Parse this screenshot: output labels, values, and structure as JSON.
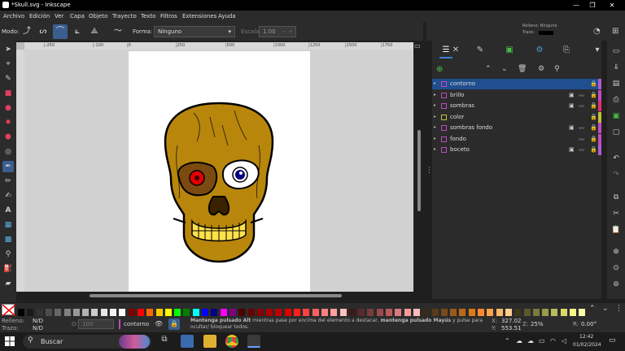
{
  "window": {
    "title": "*Skull.svg - Inkscape"
  },
  "menu": [
    "Archivo",
    "Edición",
    "Ver",
    "Capa",
    "Objeto",
    "Trayecto",
    "Texto",
    "Filtros",
    "Extensiones",
    "Ayuda"
  ],
  "commandbar": {
    "mode_label": "Modo:",
    "forma_label": "Forma:",
    "forma_value": "Ninguno",
    "escala_label": "Escala:",
    "escala_value": "1.00"
  },
  "style_indicator": {
    "relleno": "Relleno: Ninguno",
    "trazo": "Trazo:"
  },
  "ruler": {
    "ticks": [
      "|-250",
      "|-100",
      "|0",
      "|250",
      "|500",
      "|1000",
      "|1250",
      "|1500",
      "|1750"
    ]
  },
  "layers": [
    {
      "name": "contorno",
      "selected": true,
      "icons": [
        "lock"
      ],
      "color": "#b05ad0"
    },
    {
      "name": "brillo",
      "icons": [
        "mask",
        "visible",
        "lock"
      ],
      "color": "#c04ac0"
    },
    {
      "name": "sombras",
      "icons": [
        "mask",
        "visible",
        "lock"
      ],
      "color": "#e0306a"
    },
    {
      "name": "color",
      "icons": [
        "lock"
      ],
      "color": "#c0c040"
    },
    {
      "name": "sombras fondo",
      "icons": [
        "mask",
        "visible",
        "lock"
      ],
      "color": "#c04ac0"
    },
    {
      "name": "fondo",
      "icons": [
        "visible",
        "lock"
      ],
      "color": "#c04ac0"
    },
    {
      "name": "boceto",
      "icons": [
        "mask",
        "visible",
        "lock"
      ],
      "color": "#b05ad0"
    }
  ],
  "status": {
    "relleno_label": "Relleno:",
    "relleno_value": "N/D",
    "trazo_label": "Trazo:",
    "trazo_value": "N/D",
    "opacity_label": "O:",
    "opacity_value": "100",
    "layer_name": "contorno",
    "message_bold1": "Mantenga pulsado Alt",
    "message_1": " mientras pase por encima del elemento a destacar, ",
    "message_bold2": "mantenga pulsado Mayús",
    "message_2": " y pulse para ocultar/ bloquear todos.",
    "x_label": "X:",
    "x_value": "327.02",
    "y_label": "Y:",
    "y_value": "553.51",
    "zoom_label": "Z:",
    "zoom_value": "25%",
    "rot_label": "R:",
    "rot_value": "0.00°"
  },
  "taskbar": {
    "search_placeholder": "Buscar",
    "time": "12:42",
    "date": "01/02/2024"
  },
  "palette": [
    "#000000",
    "#1a1a1a",
    "#333333",
    "#4d4d4d",
    "#666666",
    "#808080",
    "#999999",
    "#b3b3b3",
    "#cccccc",
    "#e6e6e6",
    "#f2f2f2",
    "#ffffff",
    "#800000",
    "#ff0000",
    "#ff6600",
    "#ffcc00",
    "#ffff00",
    "#00ff00",
    "#008000",
    "#00ffff",
    "#0000ff",
    "#000080",
    "#ff00ff",
    "#800080",
    "#4a0000",
    "#6a0000",
    "#8a0000",
    "#aa0000",
    "#c00000",
    "#e00000",
    "#ff2020",
    "#ff4040",
    "#ff6060",
    "#ff8080",
    "#ffa0a0",
    "#ffc0c0",
    "#3a1a1a",
    "#5a2a2a",
    "#7a3a3a",
    "#9a4a4a",
    "#ba5a5a",
    "#da7a7a",
    "#fa9a9a",
    "#ffbaba",
    "#3a2a1a",
    "#5a3a1a",
    "#7a4a1a",
    "#9a5a1a",
    "#ba6a1a",
    "#da7a1a",
    "#fa8a2a",
    "#ffa04a",
    "#ffb86a",
    "#ffd08a",
    "#3a3a1a",
    "#5a5a2a",
    "#7a7a3a",
    "#9a9a4a",
    "#baba5a",
    "#dada6a",
    "#fafa8a",
    "#ffffaa"
  ]
}
